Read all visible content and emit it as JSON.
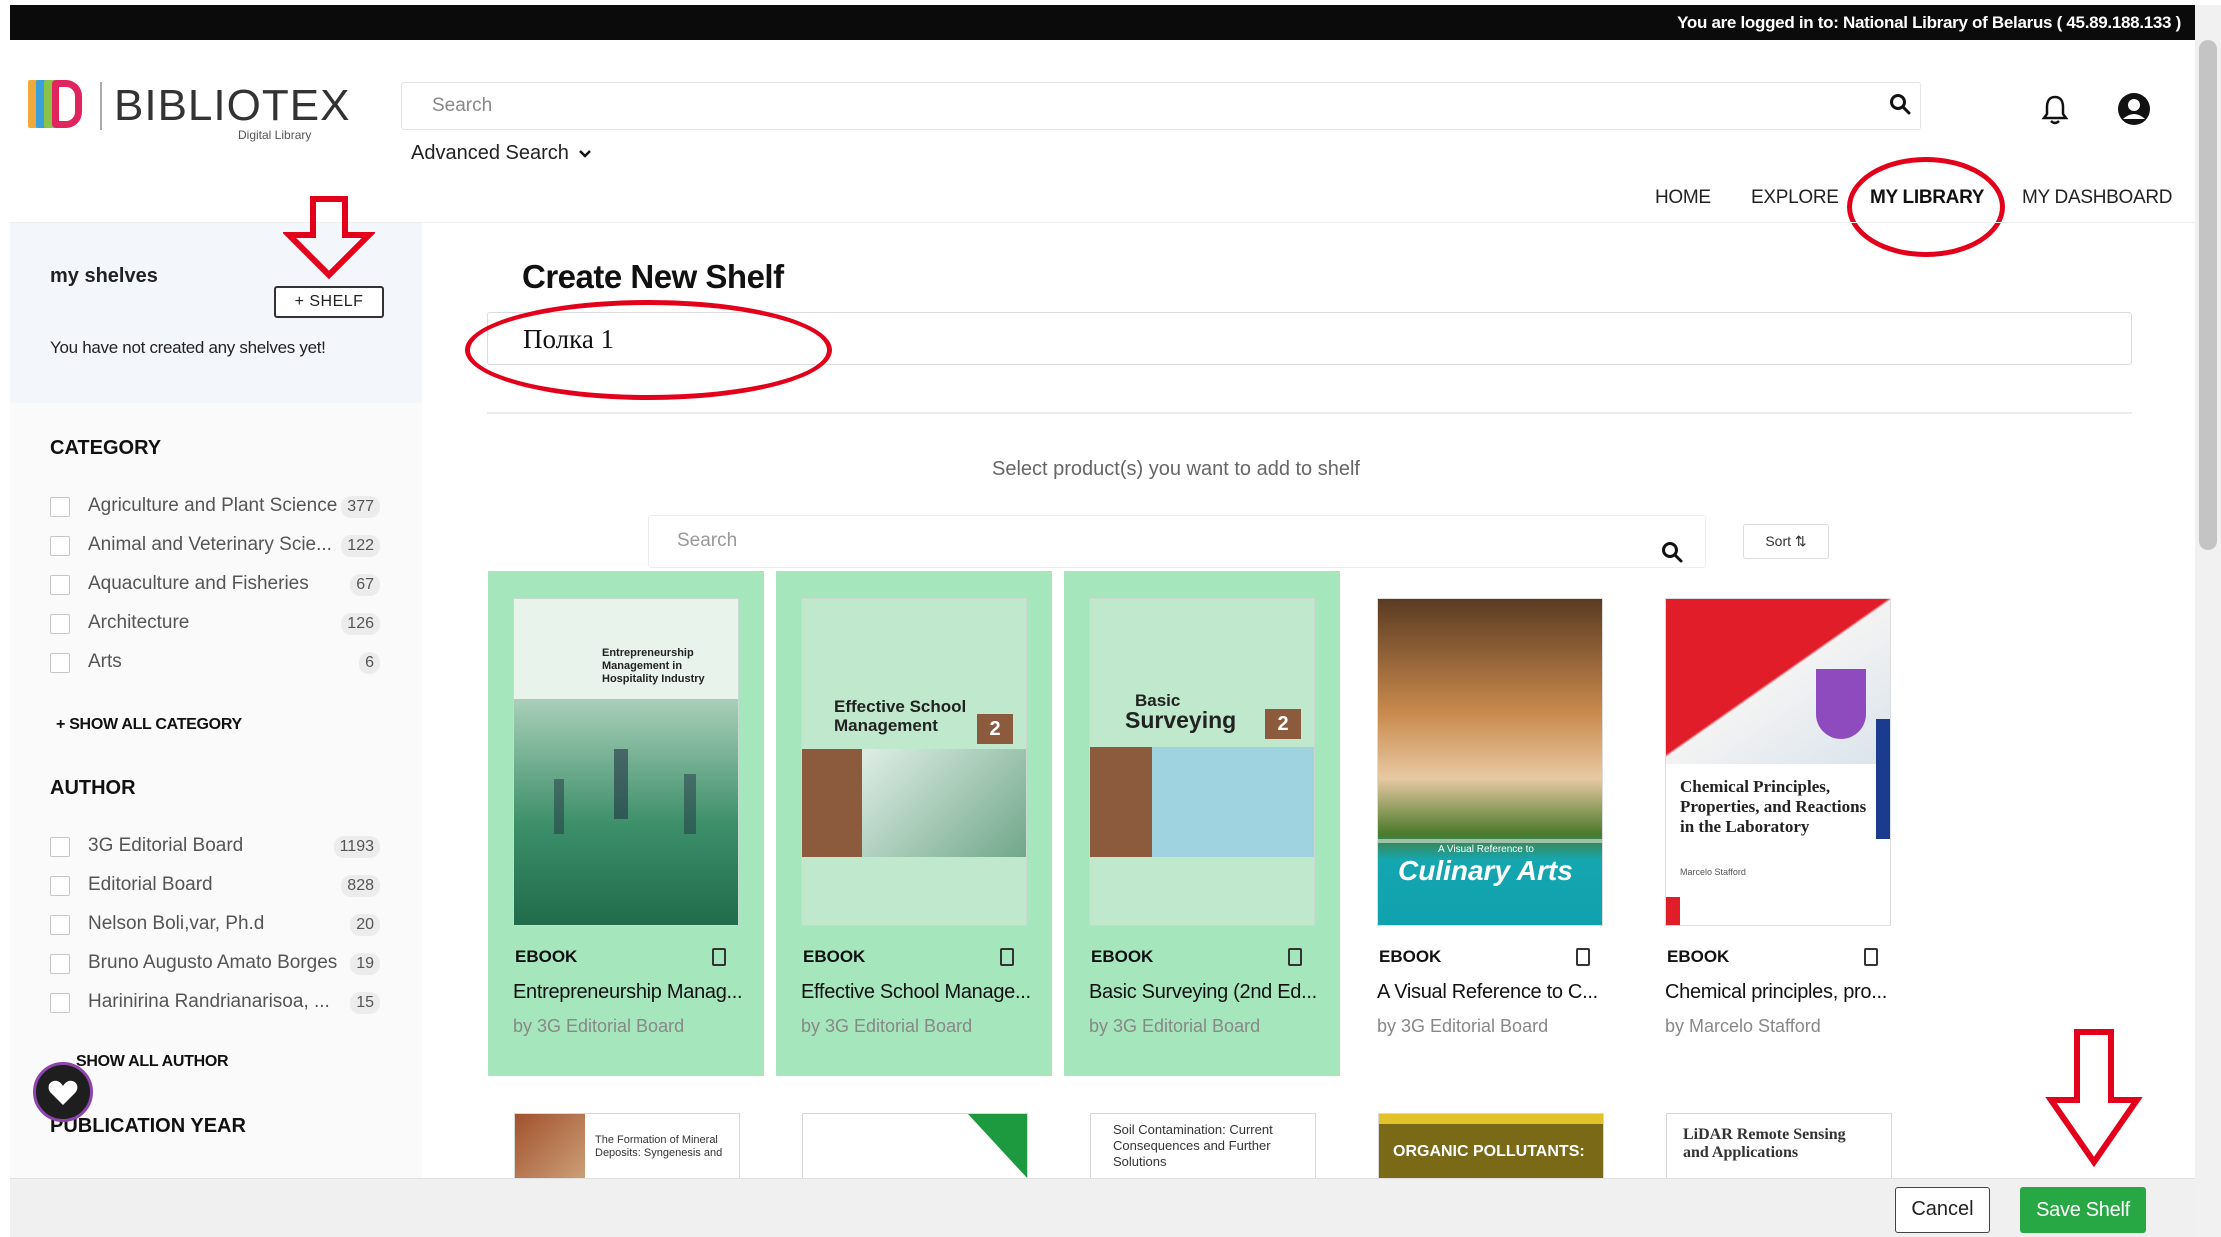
{
  "session": {
    "logged_in_text": "You are logged in to: National Library of Belarus ( 45.89.188.133 )"
  },
  "header": {
    "logo_text": "BIBLIOTEX",
    "logo_subtitle": "Digital Library",
    "search_placeholder": "Search",
    "advanced_search_label": "Advanced Search",
    "icons": [
      "search-icon",
      "bell-icon",
      "user-account-icon",
      "chevron-down-icon"
    ]
  },
  "nav": {
    "home": "HOME",
    "explore": "EXPLORE",
    "my_library": "MY LIBRARY",
    "my_dashboard": "MY DASHBOARD",
    "active": "MY LIBRARY"
  },
  "sidebar": {
    "shelves_title": "my shelves",
    "add_shelf_label": "+ SHELF",
    "empty_text": "You have not created any shelves yet!",
    "category": {
      "heading": "CATEGORY",
      "items": [
        {
          "label": "Agriculture and Plant Science",
          "count": "377",
          "checked": false
        },
        {
          "label": "Animal and Veterinary Scie...",
          "count": "122",
          "checked": false
        },
        {
          "label": "Aquaculture and Fisheries",
          "count": "67",
          "checked": false
        },
        {
          "label": "Architecture",
          "count": "126",
          "checked": false
        },
        {
          "label": "Arts",
          "count": "6",
          "checked": false
        }
      ],
      "show_all": "+ SHOW ALL CATEGORY"
    },
    "author": {
      "heading": "AUTHOR",
      "items": [
        {
          "label": "3G Editorial Board",
          "count": "1193",
          "checked": false
        },
        {
          "label": "Editorial Board",
          "count": "828",
          "checked": false
        },
        {
          "label": "Nelson Boli,var, Ph.d",
          "count": "20",
          "checked": false
        },
        {
          "label": "Bruno Augusto Amato Borges",
          "count": "19",
          "checked": false
        },
        {
          "label": "Harinirina Randrianarisoa, ...",
          "count": "15",
          "checked": false
        }
      ],
      "show_all": "SHOW ALL AUTHOR"
    },
    "publication_year_heading": "PUBLICATION YEAR"
  },
  "main": {
    "title": "Create New Shelf",
    "shelf_name_value": "Полка 1",
    "select_hint": "Select product(s) you want to add to shelf",
    "product_search_placeholder": "Search",
    "sort_label": "Sort",
    "products": [
      {
        "type": "EBOOK",
        "title": "Entrepreneurship Manag...",
        "by": "by 3G Editorial Board",
        "selected": true,
        "cover_text": "Entrepreneurship Management in Hospitality Industry"
      },
      {
        "type": "EBOOK",
        "title": "Effective School Manage...",
        "by": "by 3G Editorial Board",
        "selected": true,
        "cover_text": "Effective School Management",
        "edition": "2"
      },
      {
        "type": "EBOOK",
        "title": "Basic Surveying (2nd Ed...",
        "by": "by 3G Editorial Board",
        "selected": true,
        "cover_text_small": "Basic",
        "cover_text_big": "Surveying",
        "edition": "2"
      },
      {
        "type": "EBOOK",
        "title": "A Visual Reference to C...",
        "by": "by 3G Editorial Board",
        "selected": false,
        "cover_text_small": "A Visual Reference to",
        "cover_text_big": "Culinary Arts"
      },
      {
        "type": "EBOOK",
        "title": "Chemical principles, pro...",
        "by": "by Marcelo Stafford",
        "selected": false,
        "cover_text": "Chemical Principles, Properties, and Reactions in the Laboratory",
        "cover_author": "Marcelo Stafford"
      }
    ],
    "next_row_covers": [
      "The Formation of Mineral Deposits: Syngenesis and",
      "",
      "Soil Contamination: Current Consequences and Further Solutions",
      "ORGANIC POLLUTANTS:",
      "LiDAR Remote Sensing and Applications"
    ]
  },
  "footer": {
    "cancel_label": "Cancel",
    "save_label": "Save Shelf"
  },
  "colors": {
    "selected_card": "#a6e6bc",
    "save_button": "#27a844",
    "annotation_red": "#e3001b",
    "topbar": "#0b0b0b"
  }
}
